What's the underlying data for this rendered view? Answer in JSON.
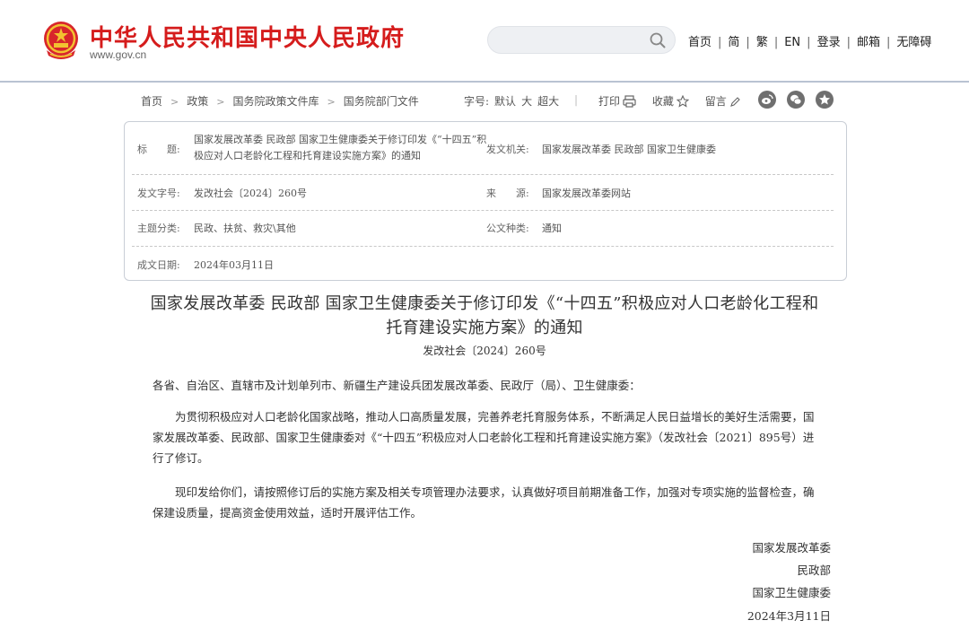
{
  "header": {
    "site_name": "中华人民共和国中央人民政府",
    "domain": "www.gov.cn",
    "search_placeholder": "",
    "nav": [
      "首页",
      "简",
      "繁",
      "EN",
      "登录",
      "邮箱",
      "无障碍"
    ],
    "separator": "|"
  },
  "breadcrumb": {
    "items": [
      "首页",
      "政策",
      "国务院政策文件库",
      "国务院部门文件"
    ],
    "arrow": ">"
  },
  "font_size": {
    "label": "字号:",
    "options": [
      "默认",
      "大",
      "超大"
    ]
  },
  "tools": {
    "print": "打印",
    "favorite": "收藏",
    "comment": "留言",
    "divider": "|"
  },
  "share_icons": [
    "weibo-icon",
    "wechat-icon",
    "star-icon"
  ],
  "info": {
    "title_label": "标　　题:",
    "title_value": "国家发展改革委 民政部 国家卫生健康委关于修订印发《“十四五”积极应对人口老龄化工程和托育建设实施方案》的通知",
    "issuer_label": "发文机关:",
    "issuer_value": "国家发展改革委 民政部 国家卫生健康委",
    "docno_label": "发文字号:",
    "docno_value": "发改社会〔2024〕260号",
    "source_label": "来　　源:",
    "source_value": "国家发展改革委网站",
    "topic_label": "主题分类:",
    "topic_value": "民政、扶贫、救灾\\其他",
    "type_label": "公文种类:",
    "type_value": "通知",
    "date_label": "成文日期:",
    "date_value": "2024年03月11日"
  },
  "article": {
    "title": "国家发展改革委 民政部 国家卫生健康委关于修订印发《“十四五”积极应对人口老龄化工程和托育建设实施方案》的通知",
    "doc_number": "发改社会〔2024〕260号",
    "salutation": "各省、自治区、直辖市及计划单列市、新疆生产建设兵团发展改革委、民政厅（局）、卫生健康委：",
    "paragraphs": [
      "为贯彻积极应对人口老龄化国家战略，推动人口高质量发展，完善养老托育服务体系，不断满足人民日益增长的美好生活需要，国家发展改革委、民政部、国家卫生健康委对《“十四五”积极应对人口老龄化工程和托育建设实施方案》（发改社会〔2021〕895号）进行了修订。",
      "现印发给你们，请按照修订后的实施方案及相关专项管理办法要求，认真做好项目前期准备工作，加强对专项实施的监督检查，确保建设质量，提高资金使用效益，适时开展评估工作。"
    ],
    "signatures": [
      "国家发展改革委",
      "民政部",
      "国家卫生健康委"
    ],
    "date": "2024年3月11日"
  },
  "colors": {
    "brand_red": "#d51c1c",
    "border": "#c9ced6"
  }
}
